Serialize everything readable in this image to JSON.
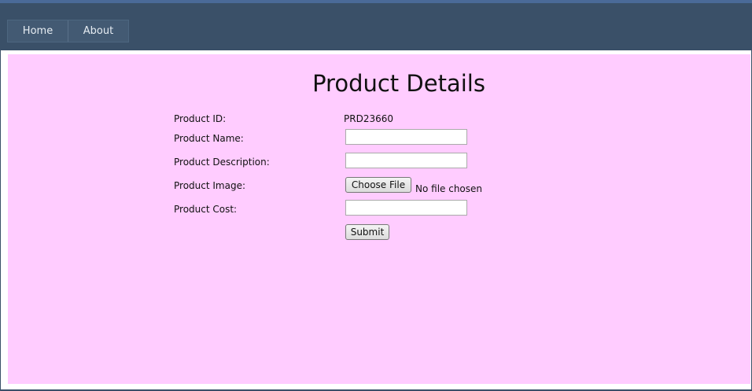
{
  "nav": {
    "home": "Home",
    "about": "About"
  },
  "page": {
    "title": "Product Details"
  },
  "form": {
    "product_id_label": "Product ID:",
    "product_id_value": "PRD23660",
    "product_name_label": "Product Name:",
    "product_name_value": "",
    "product_description_label": "Product Description:",
    "product_description_value": "",
    "product_image_label": "Product Image:",
    "choose_file_label": "Choose File",
    "no_file_text": "No file chosen",
    "product_cost_label": "Product Cost:",
    "product_cost_value": "",
    "submit_label": "Submit"
  },
  "colors": {
    "nav_bg": "#3a5068",
    "content_bg": "#ffccff"
  }
}
